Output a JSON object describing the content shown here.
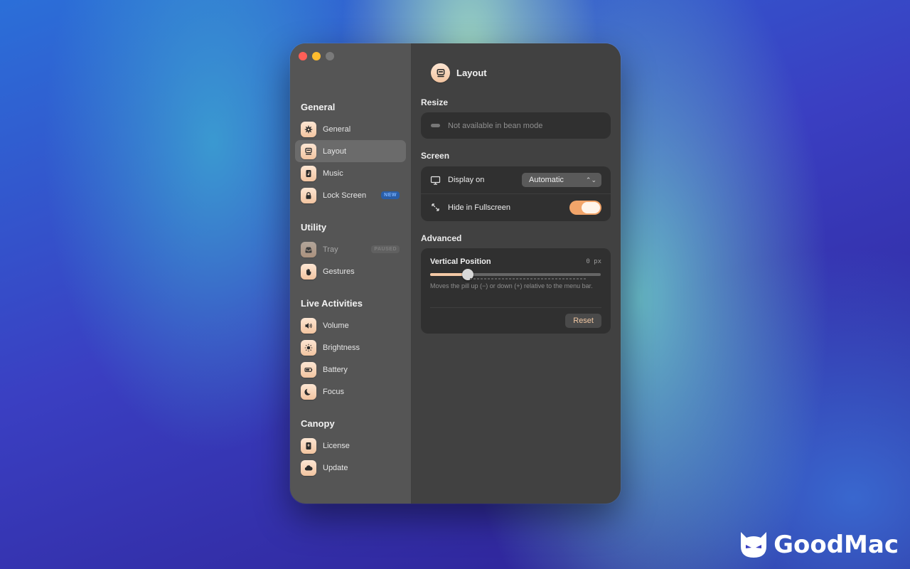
{
  "sidebar": {
    "sections": [
      {
        "title": "General",
        "items": [
          {
            "label": "General",
            "icon": "gear-icon"
          },
          {
            "label": "Layout",
            "icon": "layout-icon",
            "active": true
          },
          {
            "label": "Music",
            "icon": "music-icon"
          },
          {
            "label": "Lock Screen",
            "icon": "lock-icon",
            "badge": "NEW"
          }
        ]
      },
      {
        "title": "Utility",
        "items": [
          {
            "label": "Tray",
            "icon": "tray-icon",
            "badge": "PAUSED"
          },
          {
            "label": "Gestures",
            "icon": "hand-icon"
          }
        ]
      },
      {
        "title": "Live Activities",
        "items": [
          {
            "label": "Volume",
            "icon": "speaker-icon"
          },
          {
            "label": "Brightness",
            "icon": "sun-icon"
          },
          {
            "label": "Battery",
            "icon": "battery-icon"
          },
          {
            "label": "Focus",
            "icon": "moon-icon"
          }
        ]
      },
      {
        "title": "Canopy",
        "items": [
          {
            "label": "License",
            "icon": "license-icon"
          },
          {
            "label": "Update",
            "icon": "cloud-icon"
          }
        ]
      }
    ]
  },
  "header": {
    "title": "Layout",
    "icon": "layout-icon"
  },
  "resize": {
    "title": "Resize",
    "message": "Not available in bean mode"
  },
  "screen": {
    "title": "Screen",
    "display_label": "Display on",
    "display_value": "Automatic",
    "fullscreen_label": "Hide in Fullscreen",
    "fullscreen_enabled": true
  },
  "advanced": {
    "title": "Advanced",
    "vertical_label": "Vertical Position",
    "vertical_value": "0 px",
    "slider_fraction": 0.22,
    "description": "Moves the pill up (−) or down (+) relative to the menu bar.",
    "reset_label": "Reset"
  },
  "watermark": {
    "text": "GoodMac"
  },
  "colors": {
    "accent": "#f2a56a",
    "new_badge": "#2a5ea8"
  }
}
